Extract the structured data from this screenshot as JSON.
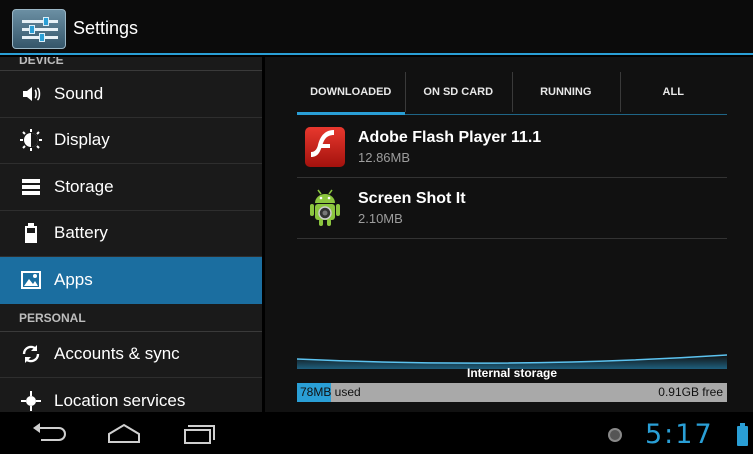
{
  "actionbar": {
    "title": "Settings",
    "icon": "settings-sliders-icon"
  },
  "sidebar": {
    "device_header": "DEVICE",
    "personal_header": "PERSONAL",
    "device_items": [
      {
        "label": "Sound",
        "icon": "speaker-icon"
      },
      {
        "label": "Display",
        "icon": "brightness-icon"
      },
      {
        "label": "Storage",
        "icon": "storage-icon"
      },
      {
        "label": "Battery",
        "icon": "battery-icon"
      },
      {
        "label": "Apps",
        "icon": "apps-icon",
        "active": true
      }
    ],
    "personal_items": [
      {
        "label": "Accounts & sync",
        "icon": "sync-icon"
      },
      {
        "label": "Location services",
        "icon": "location-icon"
      }
    ]
  },
  "tabs": [
    {
      "label": "DOWNLOADED",
      "active": true
    },
    {
      "label": "ON SD CARD"
    },
    {
      "label": "RUNNING"
    },
    {
      "label": "ALL"
    }
  ],
  "apps": [
    {
      "name": "Adobe Flash Player 11.1",
      "size": "12.86MB",
      "icon": "flash-player-icon"
    },
    {
      "name": "Screen Shot It",
      "size": "2.10MB",
      "icon": "android-app-icon"
    }
  ],
  "storage": {
    "label": "Internal storage",
    "used": "78MB used",
    "free": "0.91GB free",
    "used_fraction": 0.08
  },
  "navbar": {
    "time": "5:17",
    "buttons": [
      "back-icon",
      "home-icon",
      "recent-apps-icon"
    ]
  },
  "colors": {
    "accent": "#2a9fd6",
    "active_item": "#1b6ea0",
    "flash_red": "#c8201a",
    "android_green": "#8cc63f"
  }
}
